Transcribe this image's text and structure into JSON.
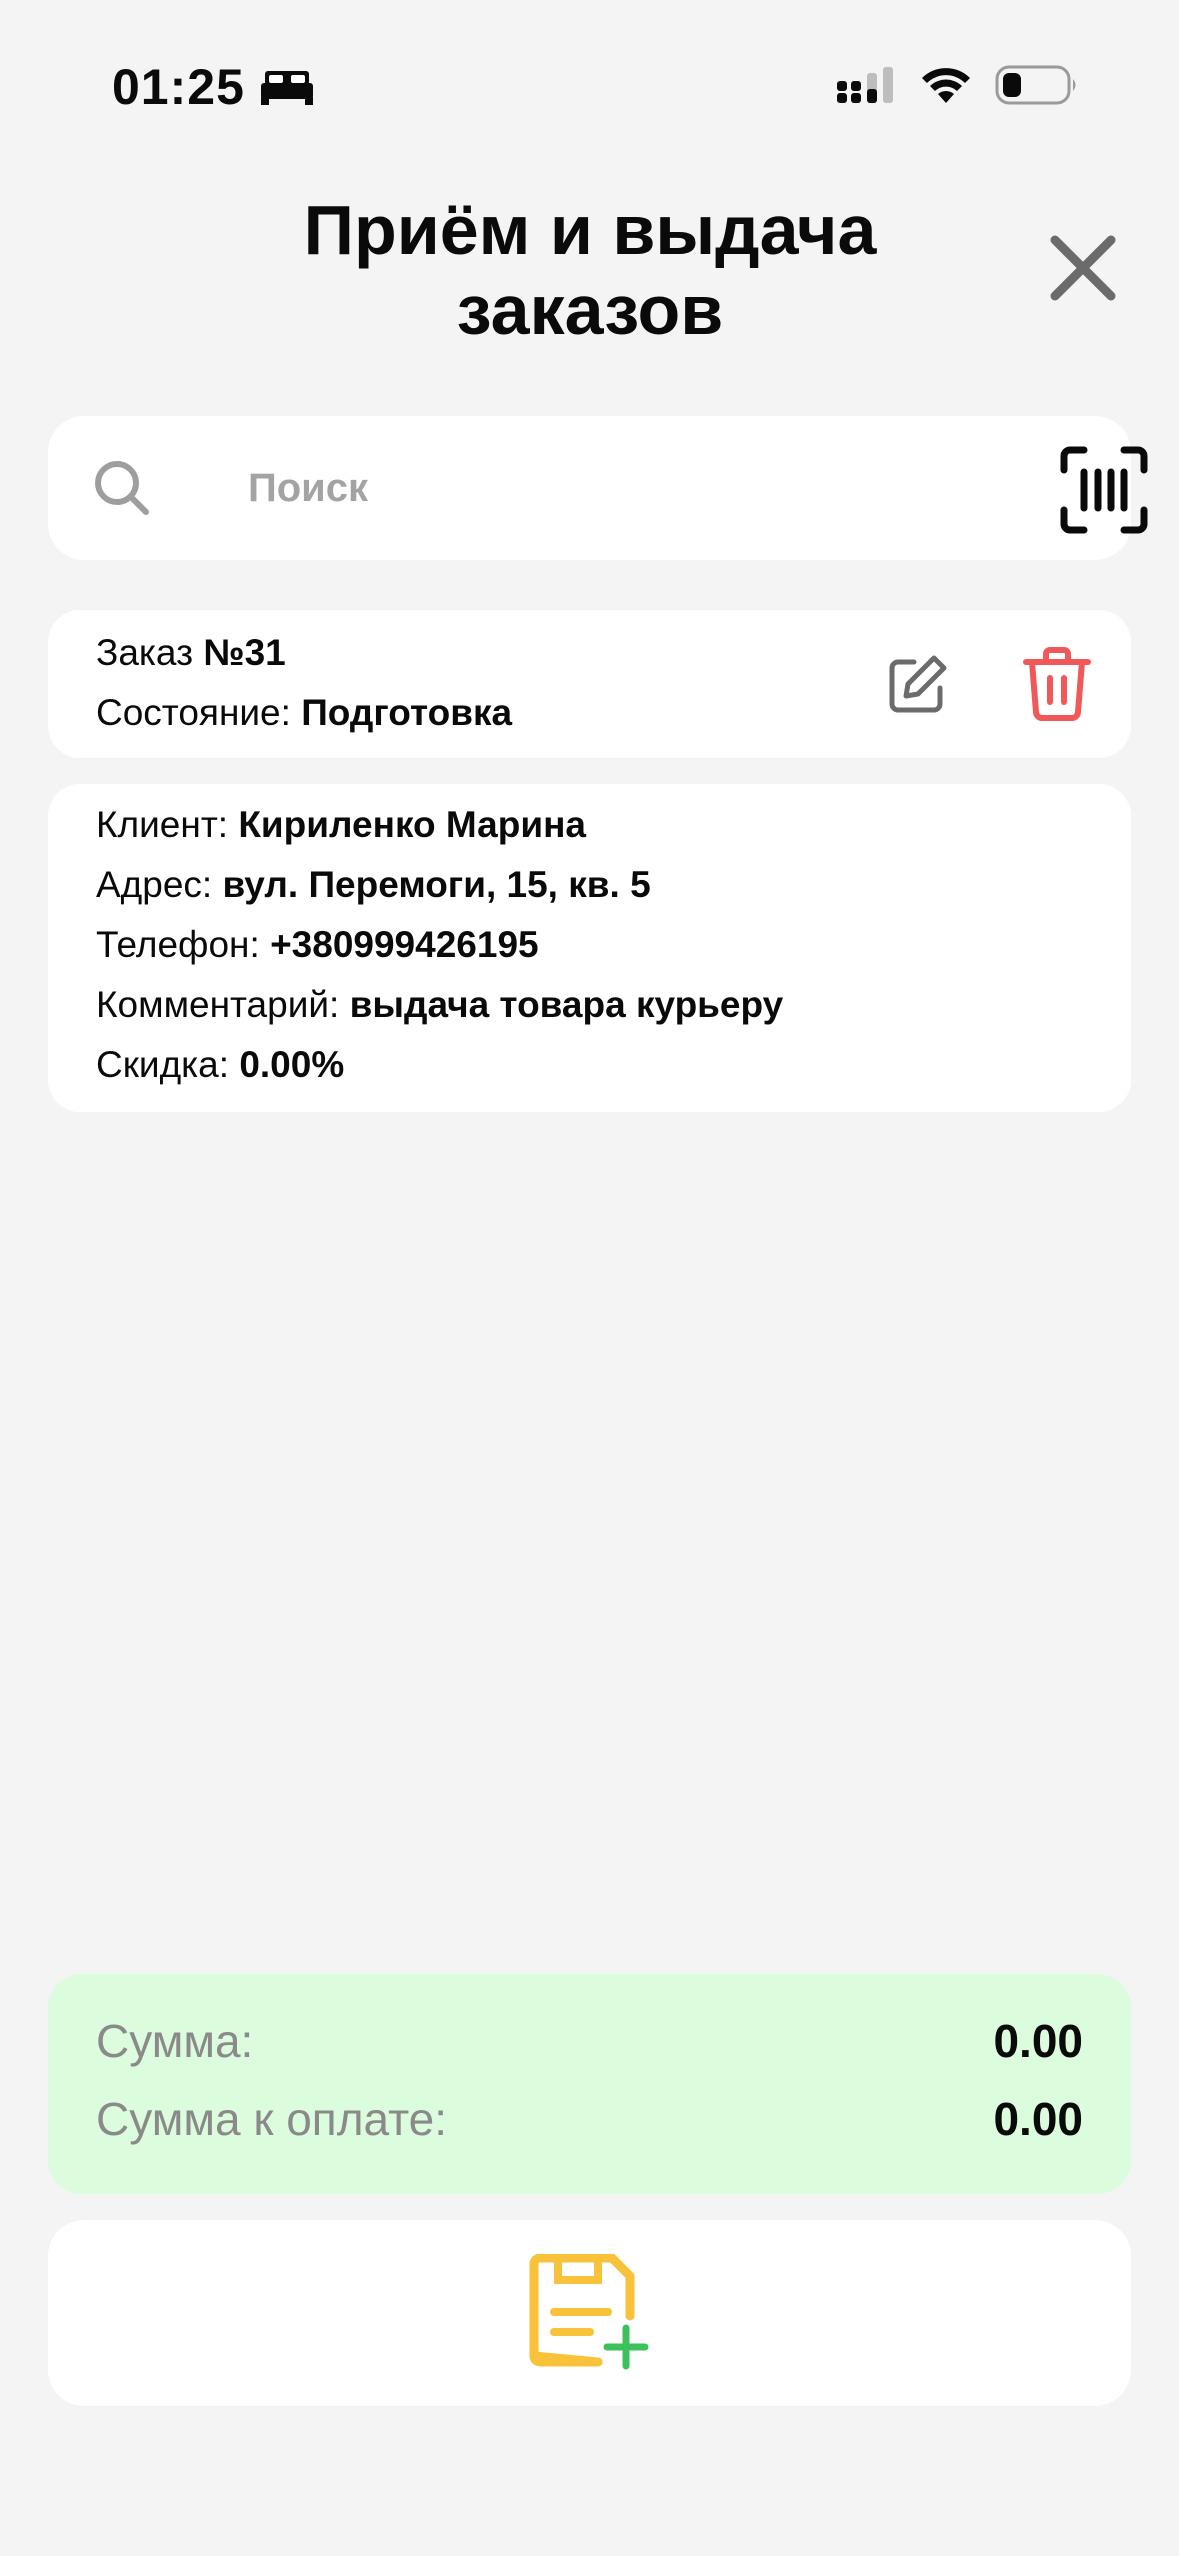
{
  "status_bar": {
    "time": "01:25",
    "sleep_icon": "bed-icon",
    "signal_icon": "cellular-signal-icon",
    "wifi_icon": "wifi-icon",
    "battery_icon": "battery-low-icon"
  },
  "header": {
    "title_line1": "Приём и выдача",
    "title_line2": "заказов",
    "close_icon": "close-icon"
  },
  "search": {
    "placeholder": "Поиск",
    "value": "",
    "search_icon": "search-icon",
    "scan_icon": "barcode-scan-icon"
  },
  "order": {
    "number_label": "Заказ",
    "number_value": "№31",
    "state_label": "Состояние:",
    "state_value": "Подготовка",
    "edit_icon": "edit-icon",
    "delete_icon": "trash-icon"
  },
  "client_info": {
    "client_label": "Клиент:",
    "client_value": "Кириленко Марина",
    "address_label": "Адрес:",
    "address_value": "вул. Перемоги, 15, кв. 5",
    "phone_label": "Телефон:",
    "phone_value": "+380999426195",
    "comment_label": "Комментарий:",
    "comment_value": "выдача товара курьеру",
    "discount_label": "Скидка:",
    "discount_value": "0.00%"
  },
  "totals": {
    "sum_label": "Сумма:",
    "sum_value": "0.00",
    "payable_label": "Сумма к оплате:",
    "payable_value": "0.00"
  },
  "save_button": {
    "icon": "save-document-add-icon"
  },
  "colors": {
    "background": "#f4f4f4",
    "card": "#ffffff",
    "totals_bg": "#dbfcdd",
    "delete": "#f0585a",
    "save_icon": "#f8c33a",
    "plus": "#3cc15b"
  }
}
